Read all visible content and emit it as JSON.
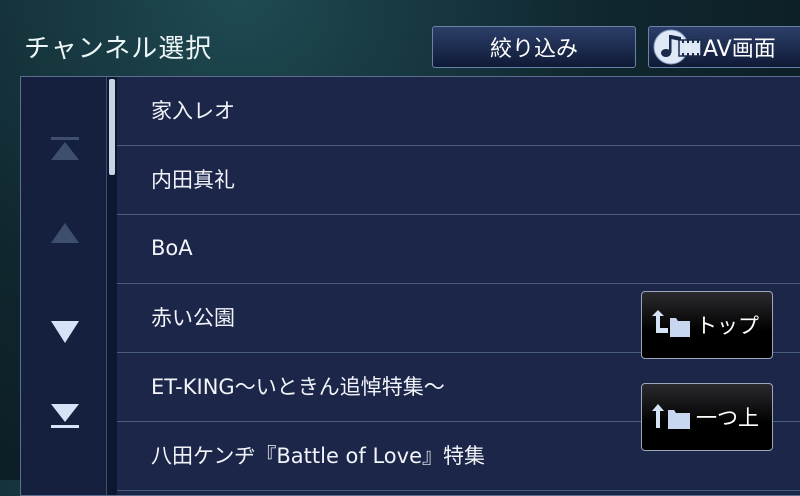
{
  "header": {
    "title": "チャンネル選択",
    "filter_label": "絞り込み",
    "av_label": "AV画面"
  },
  "nav": {
    "icons": [
      "scroll-top-icon",
      "scroll-up-icon",
      "scroll-down-icon",
      "scroll-bottom-icon"
    ]
  },
  "channels": [
    "家入レオ",
    "内田真礼",
    "BoA",
    "赤い公園",
    "ET-KING〜いときん追悼特集〜",
    "八田ケンヂ『Battle of Love』特集"
  ],
  "actions": {
    "top_label": "トップ",
    "up_one_label": "一つ上"
  },
  "colors": {
    "accent": "#c9d3e6",
    "row_bg": "#1b2648",
    "button_top": "#2c3f69"
  }
}
